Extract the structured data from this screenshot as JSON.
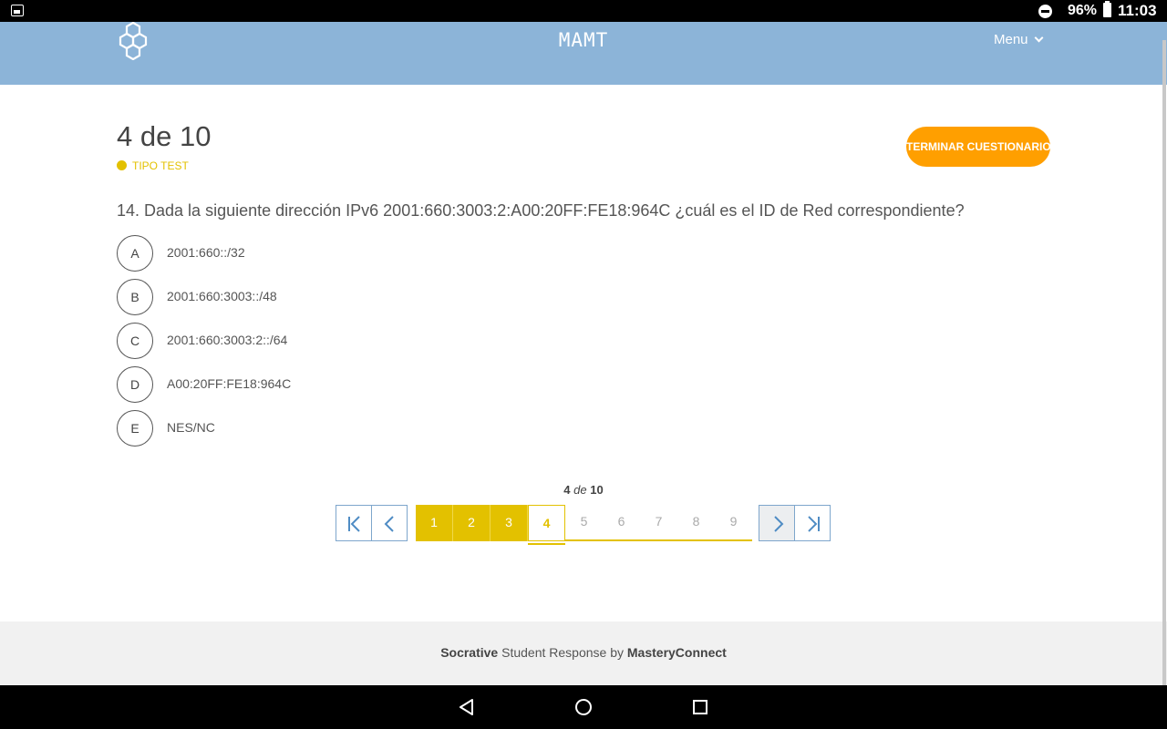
{
  "status_bar": {
    "battery": "96%",
    "time": "11:03"
  },
  "header": {
    "room_name": "MAMT",
    "menu_label": "Menu"
  },
  "quiz": {
    "progress": "4 de 10",
    "question_type": "TIPO TEST",
    "finish_button": "TERMINAR CUESTIONARIO",
    "question_text": "14. Dada la siguiente dirección IPv6 2001:660:3003:2:A00:20FF:FE18:964C ¿cuál es el ID de Red correspondiente?",
    "answers": [
      {
        "letter": "A",
        "text": "2001:660::/32"
      },
      {
        "letter": "B",
        "text": "2001:660:3003::/48"
      },
      {
        "letter": "C",
        "text": "2001:660:3003:2::/64"
      },
      {
        "letter": "D",
        "text": "A00:20FF:FE18:964C"
      },
      {
        "letter": "E",
        "text": "NES/NC"
      }
    ]
  },
  "pagination": {
    "current": "4",
    "of_word": "de",
    "total": "10",
    "pages": [
      "1",
      "2",
      "3",
      "4",
      "5",
      "6",
      "7",
      "8",
      "9"
    ],
    "answered_color": "#e3c100"
  },
  "footer": {
    "brand": "Socrative",
    "middle": " Student Response by ",
    "company": "MasteryConnect"
  },
  "colors": {
    "header_bg": "#8cb4d8",
    "accent_orange": "#ff9f00",
    "accent_yellow": "#e3c100"
  }
}
